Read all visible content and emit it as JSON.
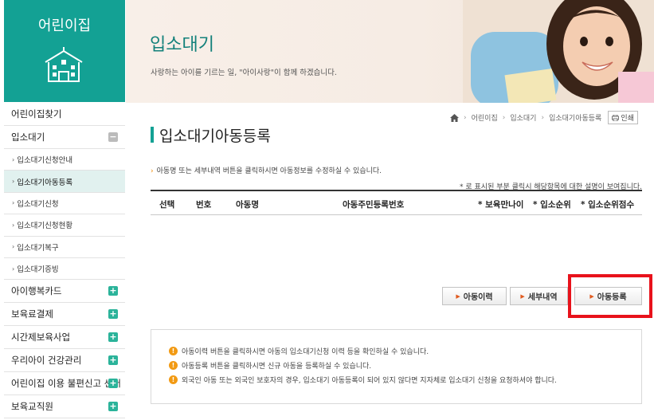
{
  "sidebar": {
    "logo_text": "어린이집",
    "items": [
      {
        "label": "어린이집찾기",
        "type": "top",
        "button": ""
      },
      {
        "label": "입소대기",
        "type": "top",
        "button": "minus"
      },
      {
        "label": "입소대기신청안내",
        "type": "sub",
        "active": false
      },
      {
        "label": "입소대기아동등록",
        "type": "sub",
        "active": true
      },
      {
        "label": "입소대기신청",
        "type": "sub",
        "active": false
      },
      {
        "label": "입소대기신청현황",
        "type": "sub",
        "active": false
      },
      {
        "label": "입소대기복구",
        "type": "sub",
        "active": false
      },
      {
        "label": "입소대기증빙",
        "type": "sub",
        "active": false
      },
      {
        "label": "아이행복카드",
        "type": "top",
        "button": "plus"
      },
      {
        "label": "보육료결제",
        "type": "top",
        "button": "plus"
      },
      {
        "label": "시간제보육사업",
        "type": "top",
        "button": "plus"
      },
      {
        "label": "우리아이 건강관리",
        "type": "top",
        "button": "plus"
      },
      {
        "label": "어린이집 이용 불편신고 센터",
        "type": "top",
        "button": "plus"
      },
      {
        "label": "보육교직원",
        "type": "top",
        "button": "plus"
      }
    ]
  },
  "banner": {
    "title": "입소대기",
    "subtitle": "사랑하는 아이를 기르는 일, \"아이사랑\"이 함께 하겠습니다."
  },
  "breadcrumb": {
    "items": [
      "어린이집",
      "입소대기",
      "입소대기아동등록"
    ],
    "print_label": "인쇄"
  },
  "page_title": "입소대기아동등록",
  "notice_top": "아동명 또는 세부내역 버튼을 클릭하시면 아동정보를 수정하실 수 있습니다.",
  "notice_right": "* 로 표시된 부분 클릭시 해당항목에 대한 설명이 보여집니다.",
  "table": {
    "columns": [
      "선택",
      "번호",
      "아동명",
      "아동주민등록번호",
      "* 보육만나이",
      "* 입소순위",
      "* 입소순위점수"
    ]
  },
  "buttons": {
    "history": "아동이력",
    "detail": "세부내역",
    "register": "아동등록"
  },
  "info": [
    "아동이력 버튼을 클릭하시면 아동의 입소대기신청 이력 등을 확인하실 수 있습니다.",
    "아동등록 버튼을 클릭하시면 신규 아동을 등록하실 수 있습니다.",
    "외국인 아동 또는 외국인 보호자의 경우, 입소대기 아동등록이 되어 있지 않다면 지자체로 입소대기 신청을 요청하셔야 합니다."
  ],
  "colors": {
    "brand": "#13a194",
    "highlight": "#e8121b",
    "info_icon": "#f29a13"
  }
}
